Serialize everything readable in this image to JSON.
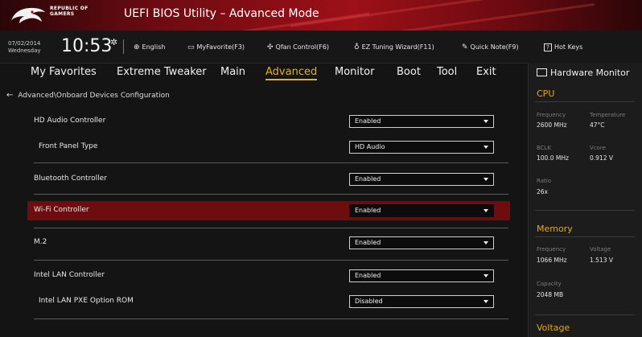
{
  "app": {
    "brand_line1": "REPUBLIC OF",
    "brand_line2": "GAMERS",
    "title": "UEFI BIOS Utility – Advanced Mode"
  },
  "status": {
    "date": "07/02/2014",
    "day": "Wednesday",
    "time": "10:53"
  },
  "toolbar": [
    {
      "label": "English",
      "icon": "globe-icon",
      "glyph": "⊕"
    },
    {
      "label": "MyFavorite(F3)",
      "icon": "favorite-card-icon",
      "glyph": "▭"
    },
    {
      "label": "Qfan Control(F6)",
      "icon": "fan-icon",
      "glyph": "✣"
    },
    {
      "label": "EZ Tuning Wizard(F11)",
      "icon": "bulb-icon",
      "glyph": "♁"
    },
    {
      "label": "Quick Note(F9)",
      "icon": "note-icon",
      "glyph": "✎"
    },
    {
      "label": "Hot Keys",
      "icon": "question-icon",
      "glyph": "?"
    }
  ],
  "tabs": [
    {
      "label": "My Favorites"
    },
    {
      "label": "Extreme Tweaker"
    },
    {
      "label": "Main"
    },
    {
      "label": "Advanced",
      "active": true
    },
    {
      "label": "Monitor"
    },
    {
      "label": "Boot"
    },
    {
      "label": "Tool"
    },
    {
      "label": "Exit"
    }
  ],
  "breadcrumb": "Advanced\\Onboard Devices Configuration",
  "settings": [
    {
      "label": "HD Audio Controller",
      "value": "Enabled"
    },
    {
      "label": "Front Panel Type",
      "value": "HD Audio"
    },
    {
      "label": "Bluetooth Controller",
      "value": "Enabled"
    },
    {
      "label": "Wi-Fi Controller",
      "value": "Enabled",
      "selected": true
    },
    {
      "label": "M.2",
      "value": "Enabled"
    },
    {
      "label": "Intel LAN Controller",
      "value": "Enabled"
    },
    {
      "label": "Intel LAN PXE Option ROM",
      "value": "Disabled"
    }
  ],
  "hardware_monitor": {
    "title": "Hardware Monitor",
    "cpu": {
      "heading": "CPU",
      "frequency_label": "Frequency",
      "frequency": "2600 MHz",
      "temperature_label": "Temperature",
      "temperature": "47°C",
      "bclk_label": "BCLK",
      "bclk": "100.0 MHz",
      "vcore_label": "Vcore",
      "vcore": "0.912 V",
      "ratio_label": "Ratio",
      "ratio": "26x"
    },
    "memory": {
      "heading": "Memory",
      "frequency_label": "Frequency",
      "frequency": "1066 MHz",
      "voltage_label": "Voltage",
      "voltage": "1.513 V",
      "capacity_label": "Capacity",
      "capacity": "2048 MB"
    },
    "voltage": {
      "heading": "Voltage"
    }
  },
  "colors": {
    "accent": "#e8b020",
    "highlight_row": "#6e0d10",
    "title_red": "#9d1018"
  }
}
